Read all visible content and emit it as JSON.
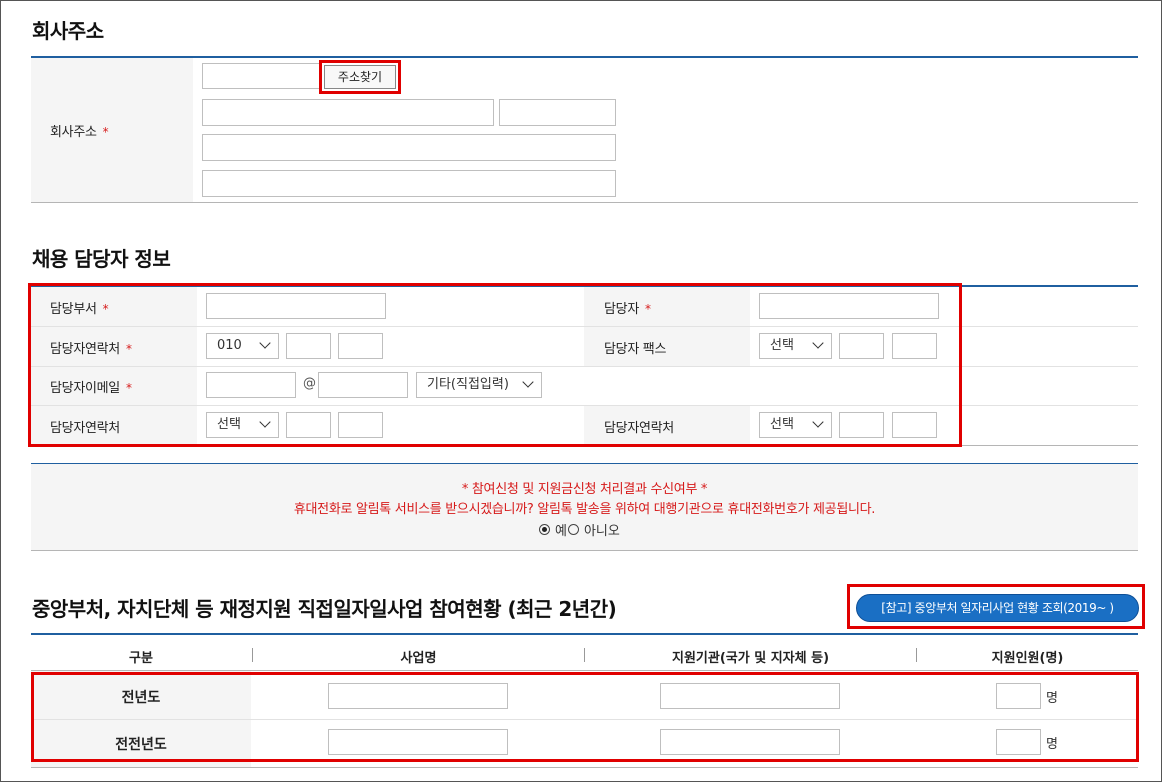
{
  "company_address": {
    "title": "회사주소",
    "label": "회사주소",
    "required_mark": "*",
    "search_button": "주소찾기"
  },
  "manager": {
    "title": "채용 담당자 정보",
    "dept_label": "담당부서",
    "name_label": "담당자",
    "phone_label": "담당자연락처",
    "phone_prefix": "010",
    "fax_label": "담당자 팩스",
    "fax_select": "선택",
    "email_label": "담당자이메일",
    "email_at": "@",
    "email_domain": "기타(직접입력)",
    "phone2_label": "담당자연락처",
    "phone2_select": "선택",
    "phone3_label": "담당자연락처",
    "phone3_select": "선택",
    "required_mark": "*"
  },
  "notice": {
    "line1": "* 참여신청 및 지원금신청 처리결과 수신여부 *",
    "line2": "휴대전화로 알림톡 서비스를 받으시겠습니까? 알림톡 발송을 위하여 대행기관으로 휴대전화번호가 제공됩니다.",
    "yes": "예",
    "no": "아니오",
    "selected": "예"
  },
  "participation": {
    "title": "중앙부처, 자치단체 등 재정지원 직접일자일사업 참여현황 (최근 2년간)",
    "ref_button": "[참고] 중앙부처 일자리사업 현황 조회(2019~ )",
    "headers": [
      "구분",
      "사업명",
      "지원기관(국가 및 지자체 등)",
      "지원인원(명)"
    ],
    "rows": [
      {
        "year": "전년도",
        "unit": "명"
      },
      {
        "year": "전전년도",
        "unit": "명"
      }
    ]
  },
  "colors": {
    "accent_blue": "#1f5fa0",
    "highlight_red": "#e00000",
    "notice_red": "#d61a1a",
    "button_blue": "#1a6fc4"
  }
}
